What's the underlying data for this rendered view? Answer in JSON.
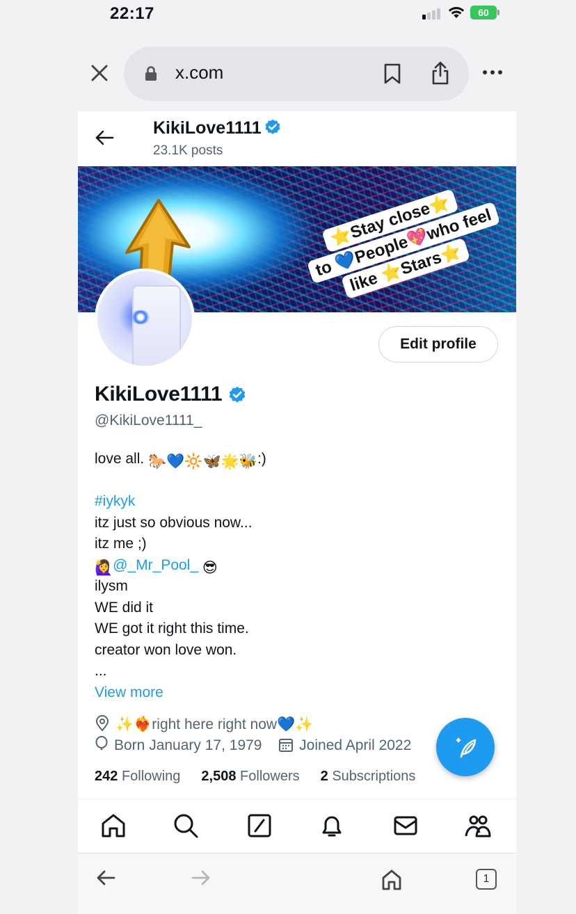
{
  "status_bar": {
    "time": "22:17",
    "battery": "60"
  },
  "browser": {
    "url": "x.com",
    "tab_count": "1"
  },
  "header": {
    "name": "KikiLove1111",
    "posts": "23.1K posts"
  },
  "banner": {
    "quote_lines": [
      "⭐Stay close⭐",
      "to 💙People💖who feel",
      "like ⭐Stars⭐"
    ]
  },
  "profile": {
    "edit_button": "Edit profile",
    "name": "KikiLove1111",
    "handle": "@KikiLove1111_",
    "bio": {
      "line1_text": "love all.",
      "line1_emoji": "🐎💙🔆🦋🌟🐝",
      "line1_tail": ":)",
      "hashtag": "#iykyk",
      "line_obvious": "itz just so obvious now...",
      "line_itz_me": "itz me ;)",
      "mention_emoji": "🙋‍♀️",
      "mention": "@_Mr_Pool_",
      "mention_tail_emoji": "😎",
      "line_ilysm": "ilysm",
      "line_we_did": "WE did it",
      "line_we_got": "WE got it right this time.",
      "line_creator": "creator won love won.",
      "ellipsis": "...",
      "view_more": "View more"
    },
    "location": "✨❤️‍🔥right here right now💙✨",
    "born": "Born January 17, 1979",
    "joined": "Joined April 2022",
    "stats": {
      "following_count": "242",
      "following_label": "Following",
      "followers_count": "2,508",
      "followers_label": "Followers",
      "subscriptions_count": "2",
      "subscriptions_label": "Subscriptions"
    }
  },
  "tabbar": {
    "icons": [
      "home-icon",
      "search-icon",
      "grok-icon",
      "notifications-icon",
      "messages-icon",
      "communities-icon"
    ]
  },
  "colors": {
    "accent": "#1d9bf0",
    "text": "#0f1419",
    "secondary": "#536471"
  }
}
